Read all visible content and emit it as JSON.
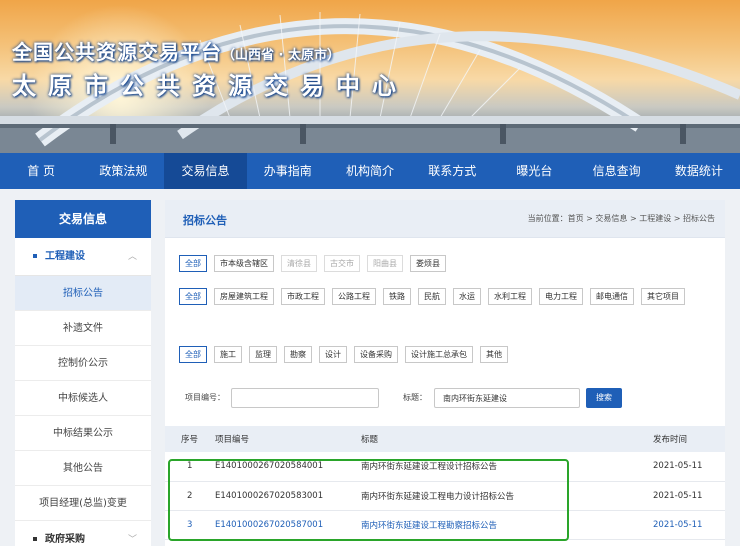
{
  "header": {
    "title_main": "全国公共资源交易平台",
    "title_region": "（山西省 · 太原市）",
    "title_center": "太原市公共资源交易中心"
  },
  "nav": [
    "首 页",
    "政策法规",
    "交易信息",
    "办事指南",
    "机构简介",
    "联系方式",
    "曝光台",
    "信息查询",
    "数据统计"
  ],
  "sidebar": {
    "title": "交易信息",
    "group1": "工程建设",
    "items": [
      "招标公告",
      "补遗文件",
      "控制价公示",
      "中标候选人",
      "中标结果公示",
      "其他公告",
      "项目经理(总监)变更"
    ],
    "group2": "政府采购"
  },
  "main": {
    "title": "招标公告",
    "breadcrumb": "当前位置：首页 > 交易信息 > 工程建设 > 招标公告",
    "region_filters": [
      "全部",
      "市本级含辖区",
      "清徐县",
      "古交市",
      "阳曲县",
      "娄烦县"
    ],
    "category_filters": [
      "全部",
      "房屋建筑工程",
      "市政工程",
      "公路工程",
      "铁路",
      "民航",
      "水运",
      "水利工程",
      "电力工程",
      "邮电通信",
      "其它项目"
    ],
    "type_filters": [
      "全部",
      "施工",
      "监理",
      "勘察",
      "设计",
      "设备采购",
      "设计施工总承包",
      "其他"
    ],
    "search": {
      "project_no_label": "项目编号：",
      "project_no_value": "",
      "title_label": "标题：",
      "title_value": "南内环街东延建设",
      "button": "搜索"
    },
    "table": {
      "headers": [
        "序号",
        "项目编号",
        "标题",
        "发布时间"
      ],
      "rows": [
        {
          "no": "1",
          "id": "E1401000267020584001",
          "title": "南内环街东延建设工程设计招标公告",
          "date": "2021-05-11"
        },
        {
          "no": "2",
          "id": "E1401000267020583001",
          "title": "南内环街东延建设工程电力设计招标公告",
          "date": "2021-05-11"
        },
        {
          "no": "3",
          "id": "E1401000267020587001",
          "title": "南内环街东延建设工程勘察招标公告",
          "date": "2021-05-11"
        }
      ]
    }
  }
}
